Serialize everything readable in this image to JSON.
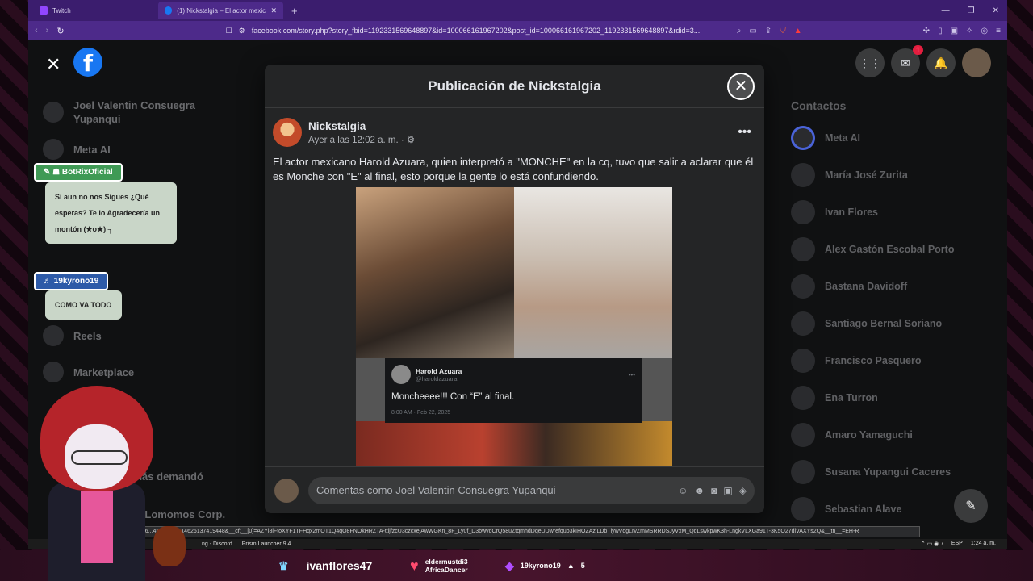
{
  "browser": {
    "tabs": [
      {
        "label": "Twitch",
        "active": false
      },
      {
        "label": "(1) Nickstalgia – El actor mexican",
        "active": true
      }
    ],
    "url": "facebook.com/story.php?story_fbid=1192331569648897&id=100066161967202&post_id=100066161967202_1192331569648897&rdid=3..."
  },
  "facebook": {
    "contacts_title": "Contactos",
    "notification_count": "1",
    "sidebar": [
      {
        "label": "Joel Valentin Consuegra Yupanqui"
      },
      {
        "label": "Meta AI"
      },
      {
        "label": "Reels"
      },
      {
        "label": "Marketplace"
      },
      {
        "label": "Lo más demandó"
      },
      {
        "label": "o x Lomomos Corp."
      }
    ],
    "contacts": [
      {
        "name": "Meta AI"
      },
      {
        "name": "María José Zurita"
      },
      {
        "name": "Ivan Flores"
      },
      {
        "name": "Alex Gastón Escobal Porto"
      },
      {
        "name": "Bastana Davidoff"
      },
      {
        "name": "Santiago Bernal Soriano"
      },
      {
        "name": "Francisco Pasquero"
      },
      {
        "name": "Ena Turron"
      },
      {
        "name": "Amaro Yamaguchi"
      },
      {
        "name": "Susana Yupangui Caceres"
      },
      {
        "name": "Sebastian Alave"
      }
    ],
    "modal": {
      "title": "Publicación de Nickstalgia",
      "author": "Nickstalgia",
      "time": "Ayer a las 12:02 a. m. ·",
      "text": "El actor mexicano Harold Azuara, quien interpretó a \"MONCHE\" en la cq, tuvo que salir a aclarar que él es Monche con \"E\" al final, esto porque la gente lo está confundiendo.",
      "tweet": {
        "name": "Harold Azuara",
        "handle": "@haroldazuara",
        "text": "Moncheeee!!! Con “E” al final.",
        "date": "8:00 AM · Feb 22, 2025"
      },
      "comment_placeholder": "Comentas como Joel Valentin Consuegra Yupanqui"
    },
    "status_url": "...26...458set=a.414626137419448&__cft__[0]=AZYl8iFtoXYF1TFHqx2mOT1Q4qO8FNOkHRZTA-ttljfzcU3czcxejAwWGKn_8F_Ly0f_D3bwvdCrQ58uZtqmhdDqeUDwrefquo3kIHOZAziLDbTlywVdgLrvZmMSRRDSJyVxM_QqLswkpwK3h-LngkVLXGa91T-3K5O27dlVAXYs2Q&__tn__=EH-R"
  },
  "taskbar": {
    "items": [
      "ng - Discord",
      "Prism Launcher 9.4"
    ],
    "lang": "ESP",
    "clock": "1:24 a. m."
  },
  "stream": {
    "chat": [
      {
        "user": "BotRixOficial",
        "message": "Si aun no nos Sigues ¿Qué esperas? Te lo Agradecería un montón   (★o★) ┐"
      },
      {
        "user": "19kyrono19",
        "message": "COMO VA TODO"
      }
    ],
    "bottom": {
      "top_user": "ivanflores47",
      "follower_line1": "eldermustdi3",
      "follower_line2": "AfricaDancer",
      "sub_user": "19kyrono19",
      "sub_count": "5"
    }
  }
}
